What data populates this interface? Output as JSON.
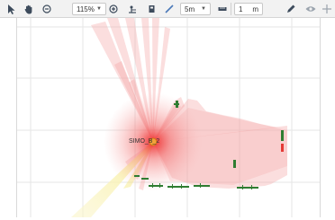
{
  "toolbar": {
    "zoom_value": "115%",
    "length_value": "5m",
    "grid_value": "1",
    "grid_unit": "m",
    "icons": [
      "select-arrow-icon",
      "pan-hand-icon",
      "zoom-out-icon",
      "zoom-in-icon",
      "pose-estimate-icon",
      "marker-icon",
      "measure-icon",
      "ruler-icon",
      "pen-icon",
      "eye-icon",
      "crosshair-icon"
    ]
  },
  "map": {
    "robot_name": "SIMO_B_2",
    "colors": {
      "laser": "#f4a0a0",
      "laser_core": "#ee2222",
      "camera_cone": "#f8f1a8",
      "obstacle": "#2f7d32",
      "obstacle_alert": "#e53935",
      "grid": "#e6e6e6"
    }
  }
}
